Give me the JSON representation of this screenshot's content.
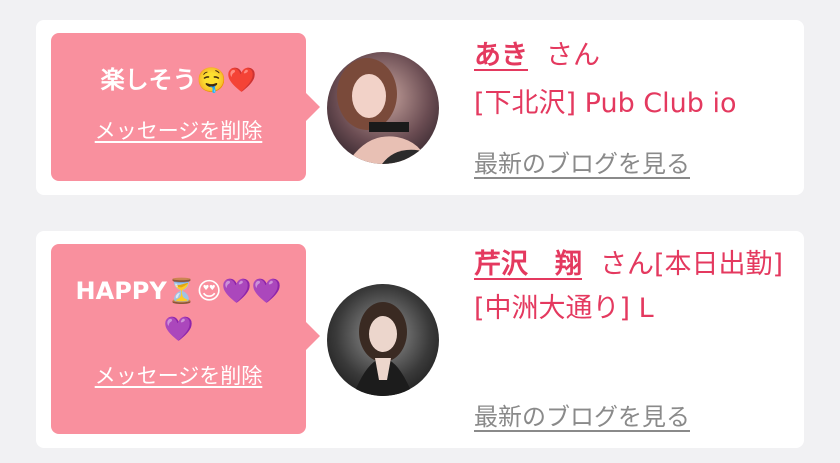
{
  "entries": [
    {
      "message": "楽しそう🤤❤️",
      "delete_label": "メッセージを削除",
      "name": "あき",
      "suffix": "さん",
      "shop": "[下北沢] Pub Club io",
      "blog_link": "最新のブログを見る"
    },
    {
      "message": "HAPPY⏳😍💜💜💜",
      "delete_label": "メッセージを削除",
      "name": "芹沢　翔",
      "suffix": "さん[本日出勤]",
      "shop": "[中洲大通り] L",
      "blog_link": "最新のブログを見る"
    }
  ],
  "colors": {
    "bubble": "#f9909e",
    "accent": "#e4395f",
    "link_gray": "#8a8a8a",
    "background": "#f1f1f3"
  }
}
